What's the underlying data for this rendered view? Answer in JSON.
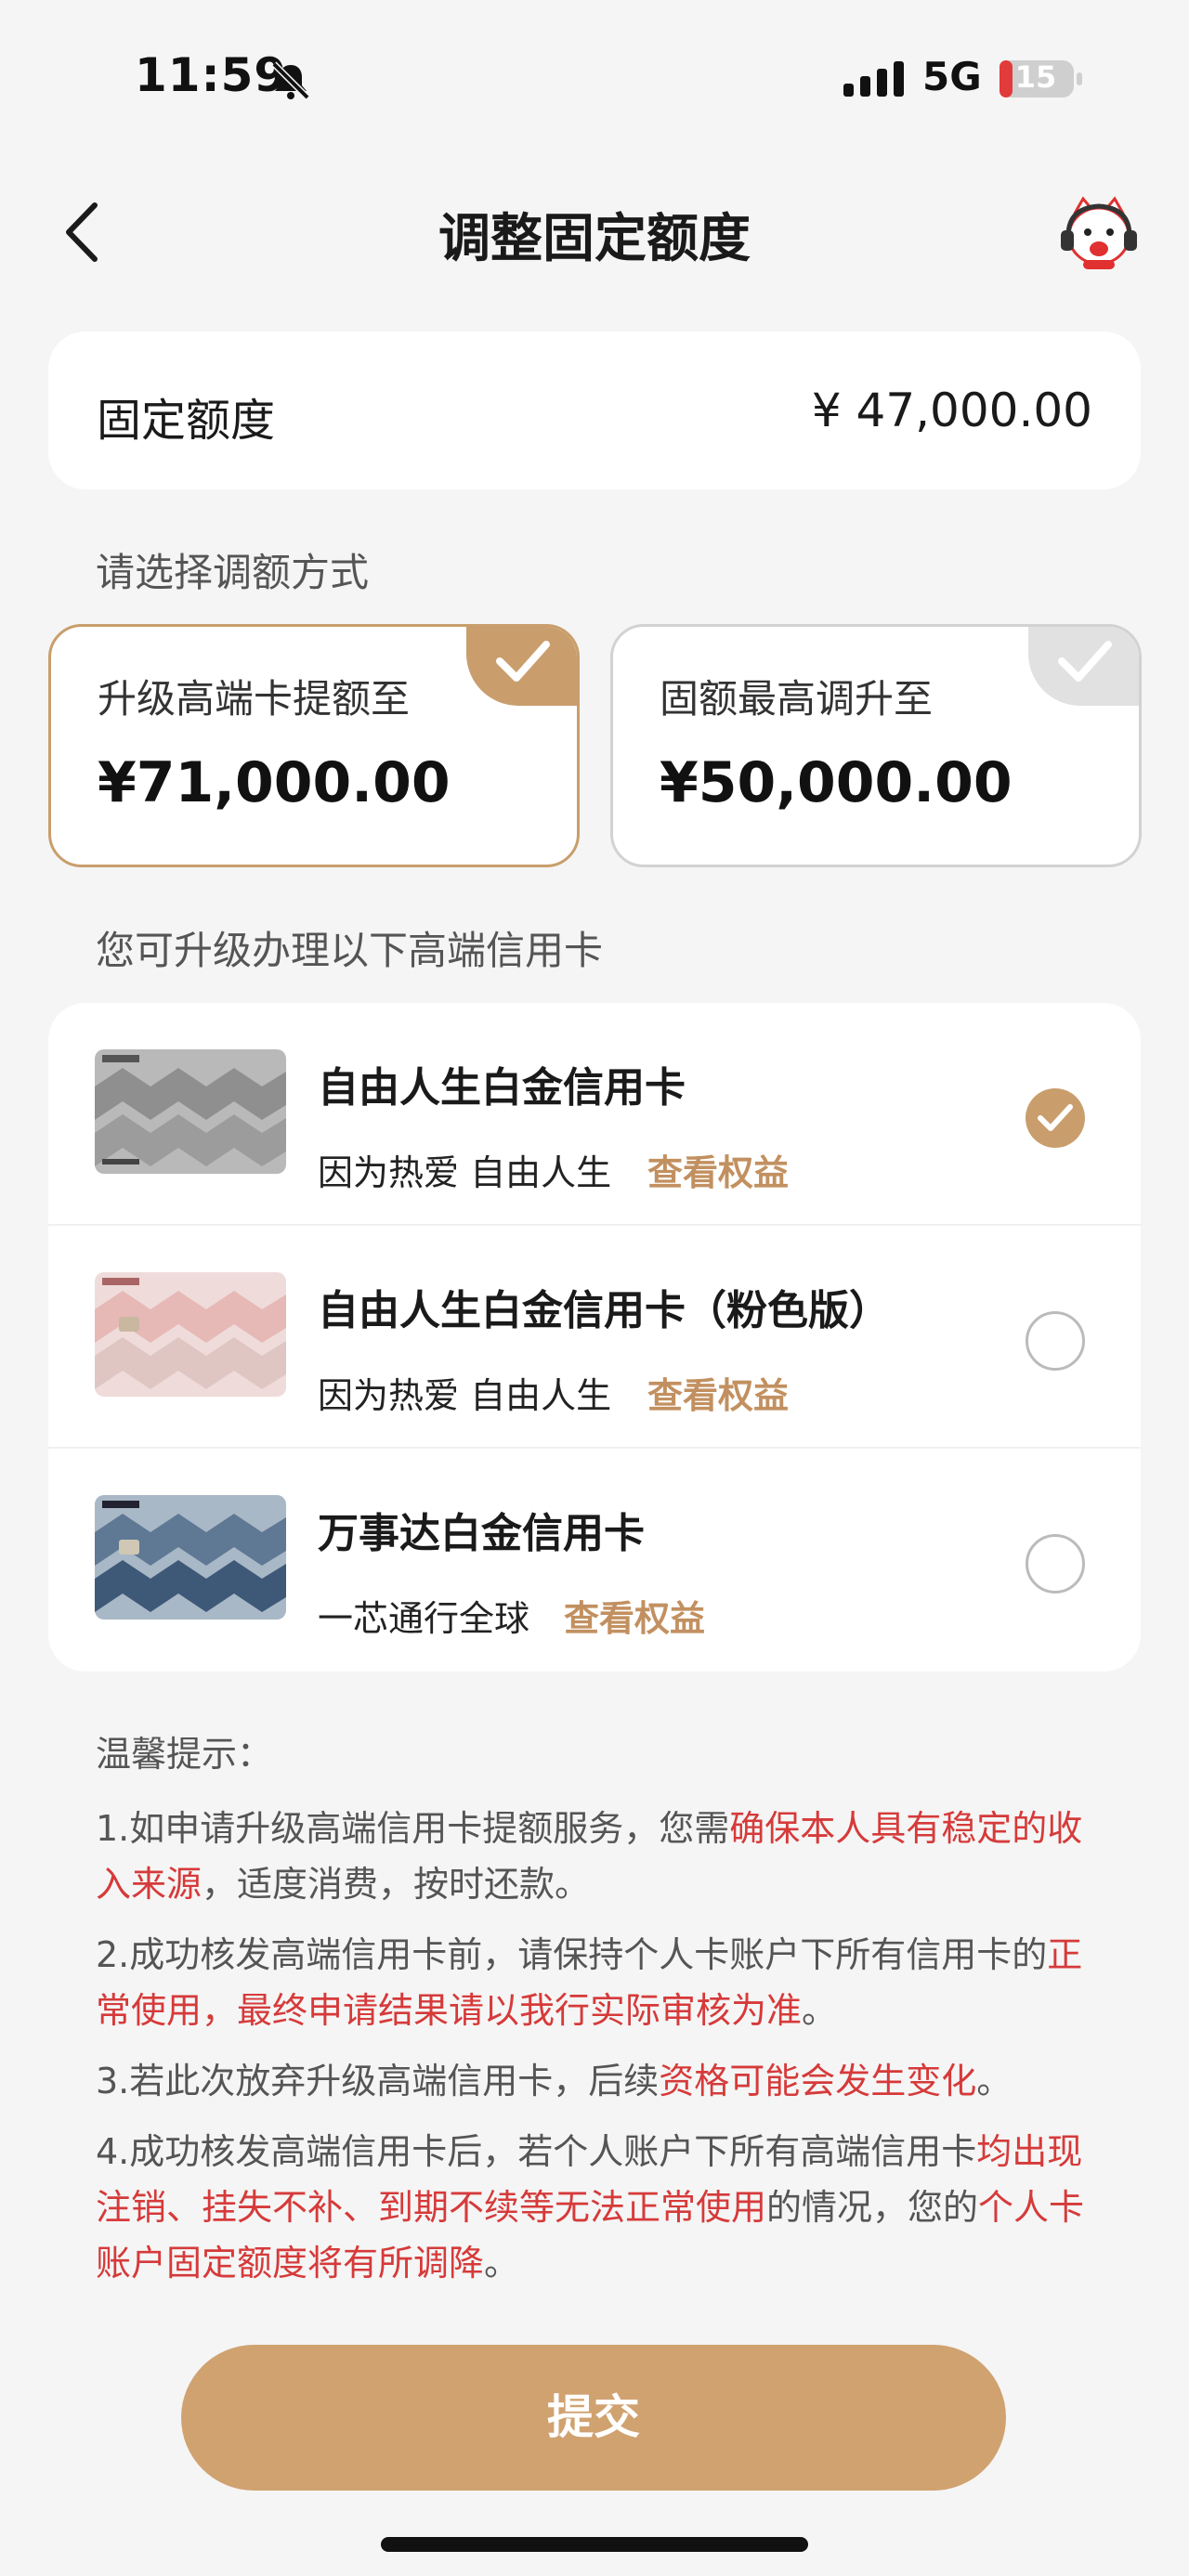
{
  "status": {
    "time": "11:59",
    "network": "5G",
    "battery": "15"
  },
  "nav": {
    "title": "调整固定额度"
  },
  "fixed": {
    "label": "固定额度",
    "value": "¥ 47,000.00"
  },
  "choose_label": "请选择调额方式",
  "options": [
    {
      "label": "升级高端卡提额至",
      "amount": "¥71,000.00",
      "selected": true
    },
    {
      "label": "固额最高调升至",
      "amount": "¥50,000.00",
      "selected": false
    }
  ],
  "cards_label": "您可升级办理以下高端信用卡",
  "cards": [
    {
      "name": "自由人生白金信用卡",
      "slogan": "因为热爱 自由人生",
      "link": "查看权益",
      "selected": true
    },
    {
      "name": "自由人生白金信用卡（粉色版）",
      "slogan": "因为热爱 自由人生",
      "link": "查看权益",
      "selected": false
    },
    {
      "name": "万事达白金信用卡",
      "slogan": "一芯通行全球",
      "link": "查看权益",
      "selected": false
    }
  ],
  "tips": {
    "title": "温馨提示：",
    "items": [
      {
        "parts": [
          {
            "t": "1.如申请升级高端信用卡提额服务，您需"
          },
          {
            "t": "确保本人具有稳定的收入来源",
            "red": true
          },
          {
            "t": "，适度消费，按时还款。"
          }
        ]
      },
      {
        "parts": [
          {
            "t": "2.成功核发高端信用卡前，请保持个人卡账户下所有信用卡的"
          },
          {
            "t": "正常使用，最终申请结果请以我行实际审核为准",
            "red": true
          },
          {
            "t": "。"
          }
        ]
      },
      {
        "parts": [
          {
            "t": "3.若此次放弃升级高端信用卡，后续"
          },
          {
            "t": "资格可能会发生变化",
            "red": true
          },
          {
            "t": "。"
          }
        ]
      },
      {
        "parts": [
          {
            "t": "4.成功核发高端信用卡后，若个人账户下所有高端信用卡"
          },
          {
            "t": "均出现注销、挂失不补、到期不续等无法正常使用",
            "red": true
          },
          {
            "t": "的情况，您的"
          },
          {
            "t": "个人卡账户固定额度将有所调降",
            "red": true
          },
          {
            "t": "。"
          }
        ]
      }
    ]
  },
  "submit_label": "提交",
  "colors": {
    "accent": "#c99e6c",
    "warning": "#d63a3a",
    "button": "#d0a270"
  }
}
